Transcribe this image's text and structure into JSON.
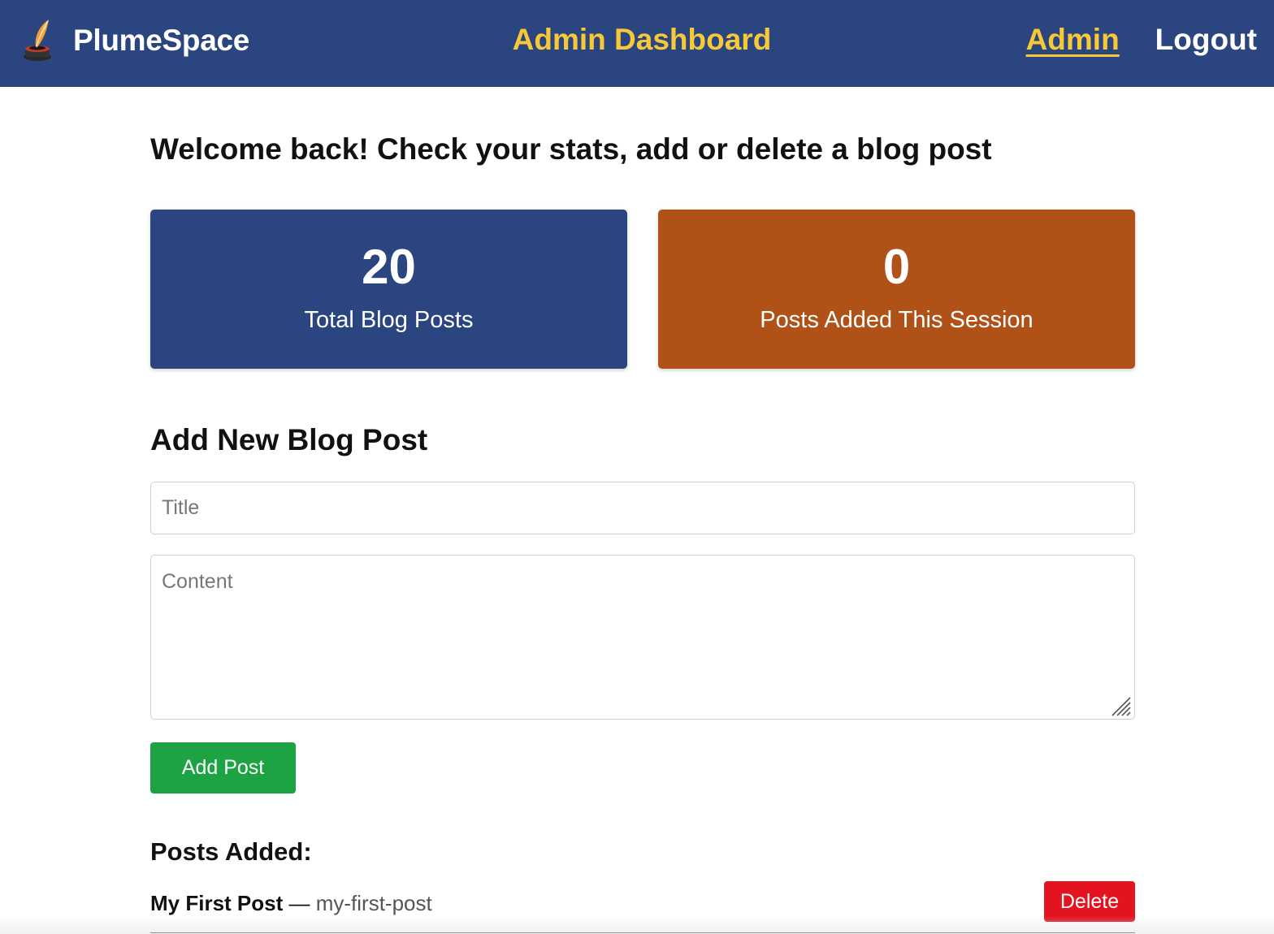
{
  "header": {
    "brand_name": "PlumeSpace",
    "brand_logo_icon": "quill-inkwell-icon",
    "title": "Admin Dashboard",
    "nav": {
      "admin_label": "Admin",
      "logout_label": "Logout"
    },
    "colors": {
      "background": "#2b4581",
      "accent": "#f7c936"
    }
  },
  "main": {
    "welcome_text": "Welcome back! Check your stats, add or delete a blog post",
    "stats": {
      "total": {
        "value": "20",
        "label": "Total Blog Posts",
        "color": "#2b4581"
      },
      "session": {
        "value": "0",
        "label": "Posts Added This Session",
        "color": "#b05218"
      }
    },
    "form": {
      "heading": "Add New Blog Post",
      "title_placeholder": "Title",
      "title_value": "",
      "content_placeholder": "Content",
      "content_value": "",
      "submit_label": "Add Post",
      "submit_color": "#1da344"
    },
    "posts": {
      "heading": "Posts Added:",
      "items": [
        {
          "title": "My First Post",
          "separator": "—",
          "slug": "my-first-post",
          "delete_label": "Delete"
        }
      ],
      "delete_color": "#e3141f"
    }
  }
}
